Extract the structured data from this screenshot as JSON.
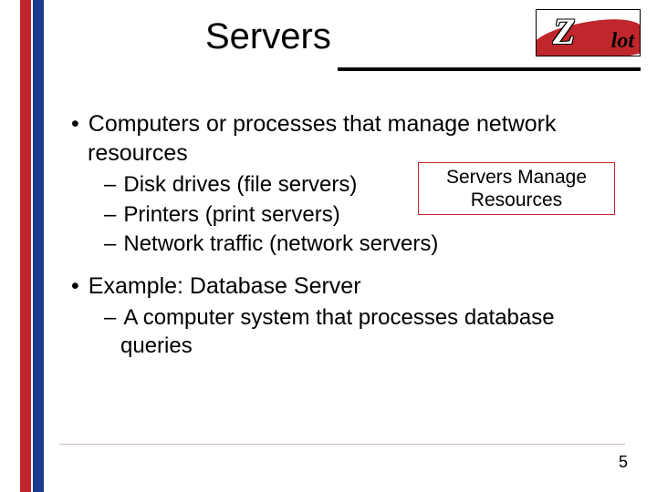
{
  "title": "Servers",
  "logo": {
    "z": "Z",
    "rest": "lot"
  },
  "bullets": {
    "b1": "Computers or processes that manage network resources",
    "s1": "Disk drives (file servers)",
    "s2": "Printers (print servers)",
    "s3": "Network traffic (network servers)",
    "b2": "Example: Database Server",
    "s4": "A computer system that processes database queries"
  },
  "callout": {
    "line1": "Servers Manage",
    "line2": "Resources"
  },
  "page": "5"
}
